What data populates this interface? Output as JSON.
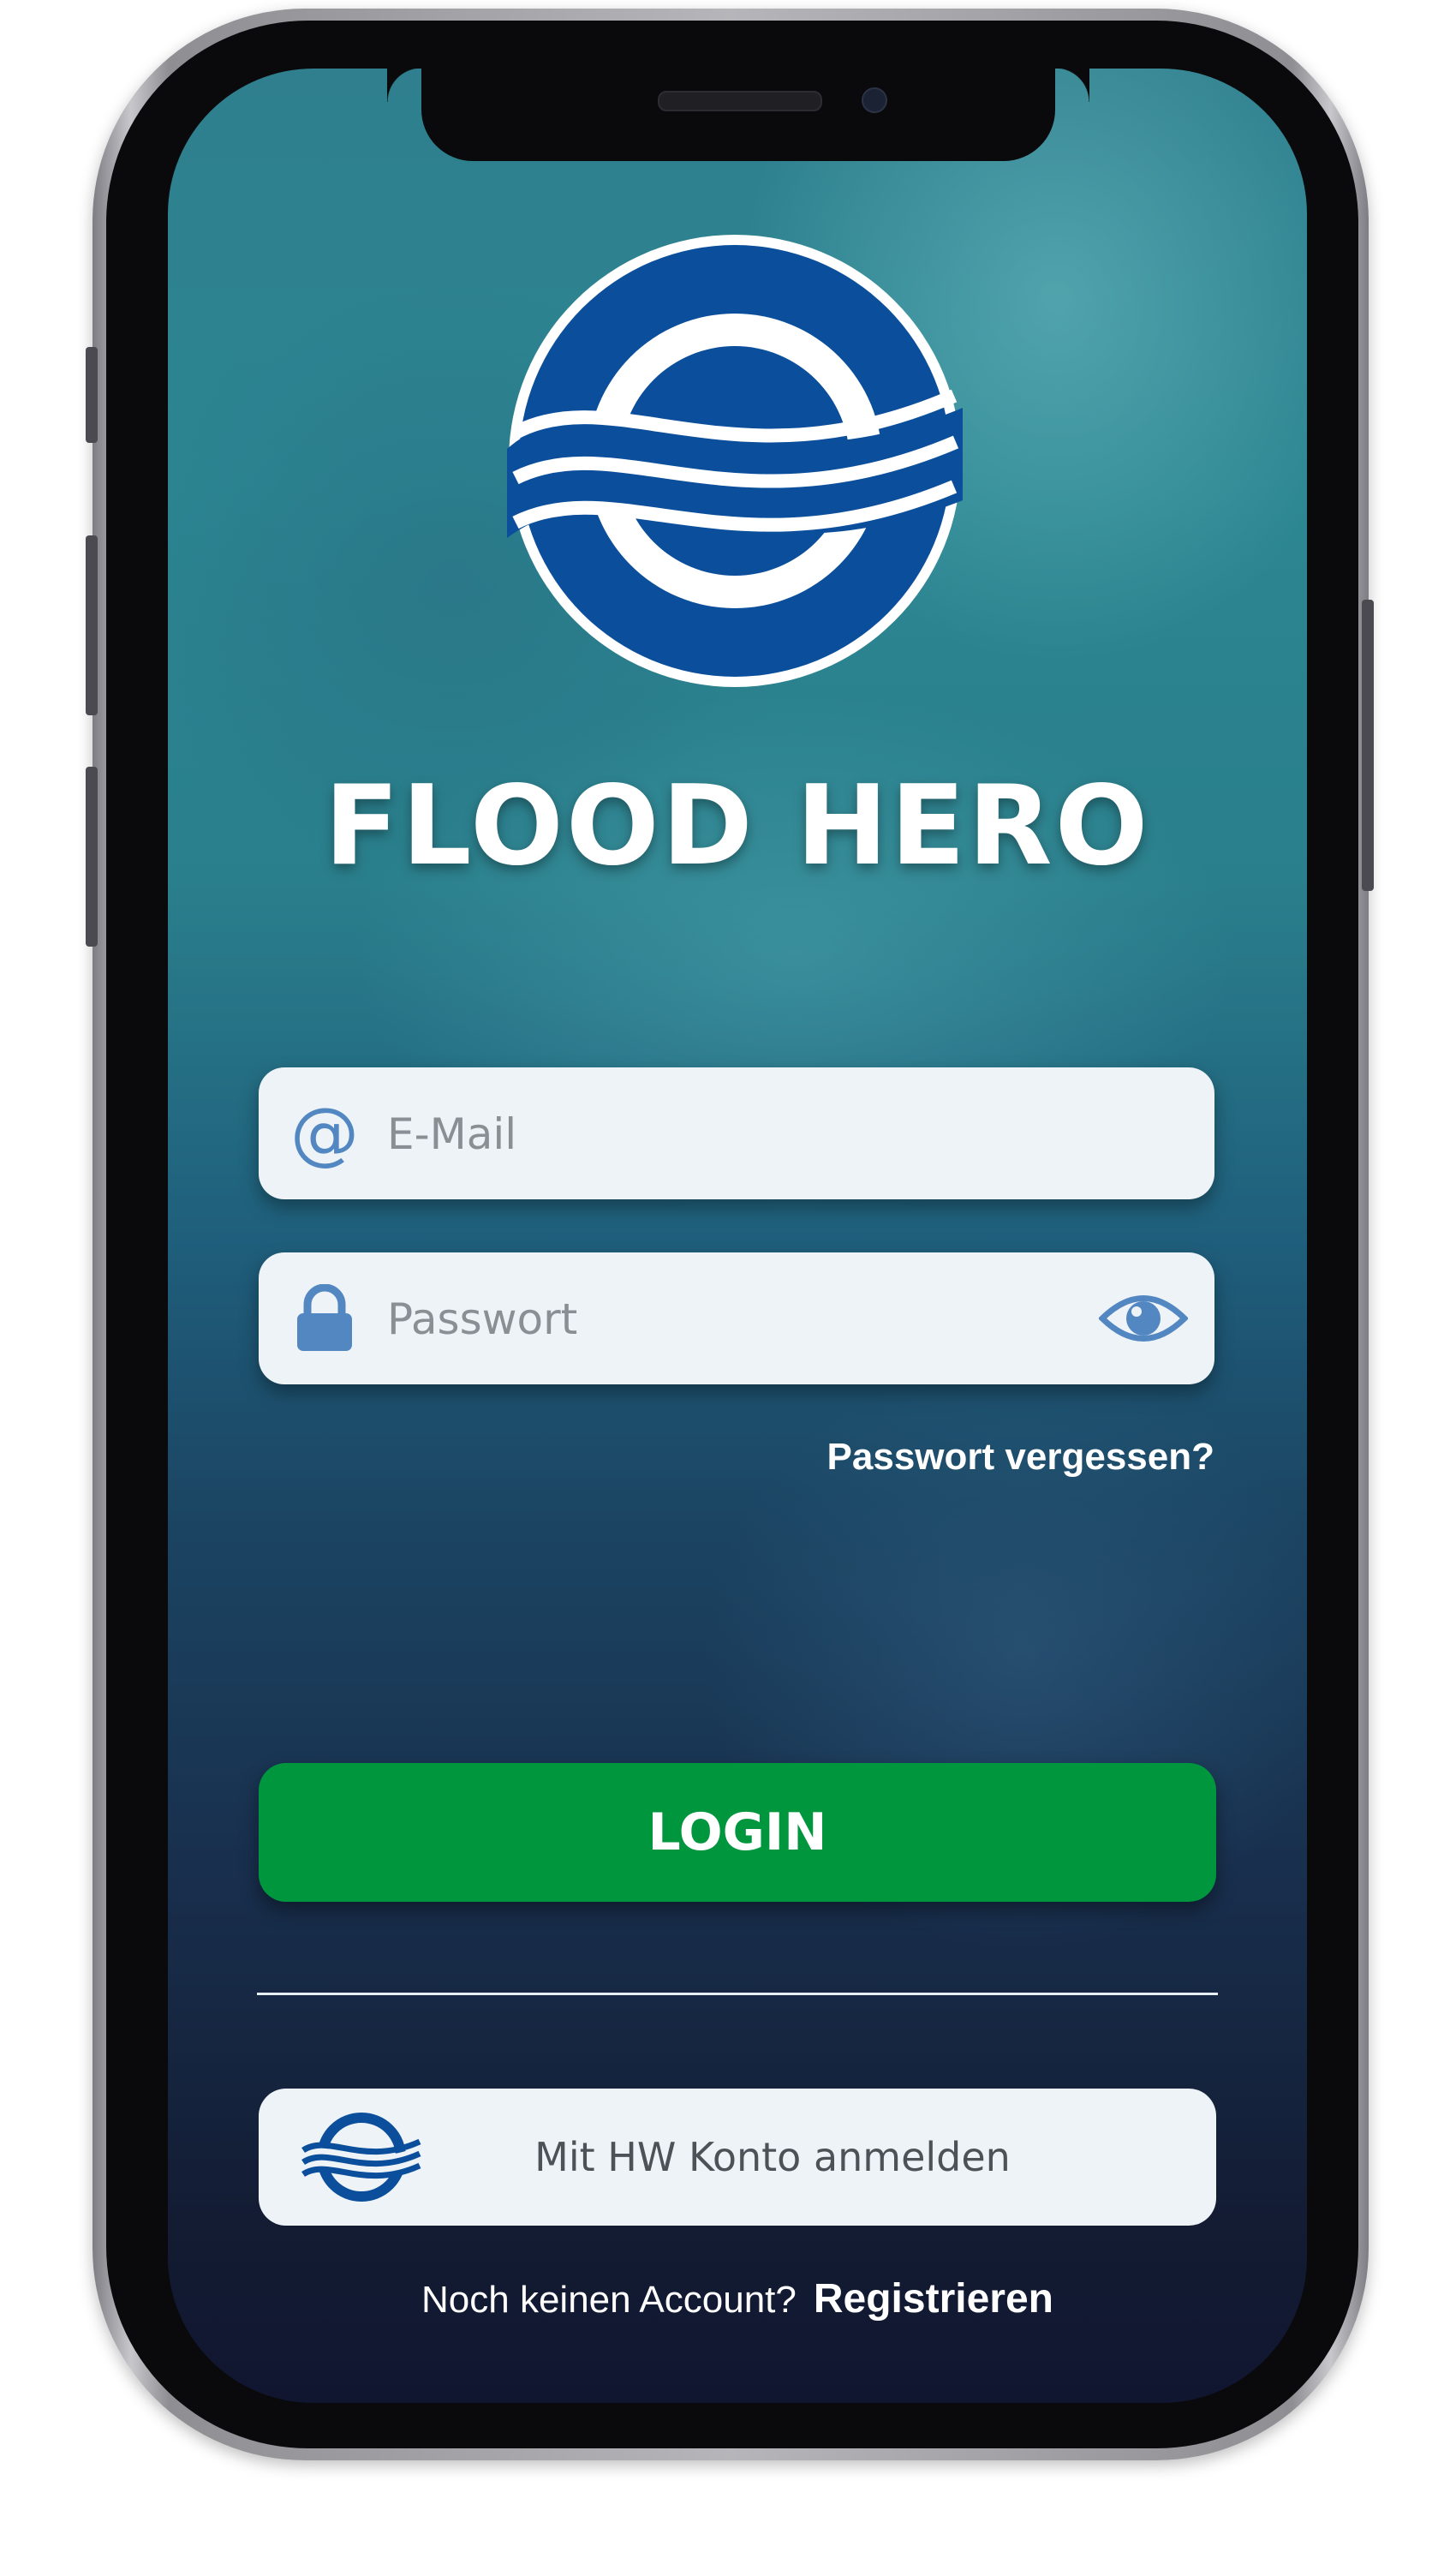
{
  "app": {
    "title": "FLOOD HERO"
  },
  "login_form": {
    "email": {
      "placeholder": "E-Mail",
      "value": "",
      "icon": "at-icon"
    },
    "password": {
      "placeholder": "Passwort",
      "value": "",
      "icon": "lock-icon",
      "toggle_icon": "eye-icon"
    },
    "forgot_password_label": "Passwort vergessen?",
    "login_label": "LOGIN"
  },
  "alt_login": {
    "label": "Mit HW Konto anmelden",
    "icon": "hw-logo-icon"
  },
  "register": {
    "prompt": "Noch keinen Account?",
    "link_label": "Registrieren"
  },
  "colors": {
    "brand_blue": "#0b4f9c",
    "accent_green": "#00963d",
    "icon_blue": "#5387c2",
    "field_background": "#eef3f7"
  }
}
